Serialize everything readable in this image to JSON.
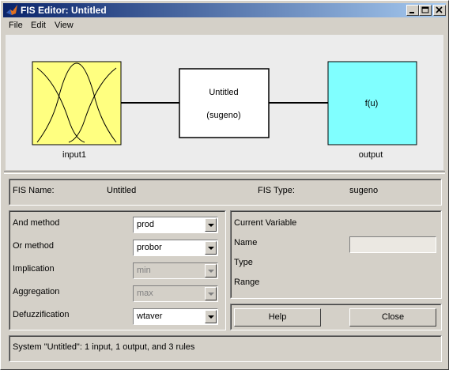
{
  "window": {
    "title": "FIS Editor: Untitled"
  },
  "menu": [
    "File",
    "Edit",
    "View"
  ],
  "diagram": {
    "input_label": "input1",
    "output_label": "output",
    "system_name": "Untitled",
    "system_type": "(sugeno)",
    "output_function": "f(u)",
    "colors": {
      "input_box": "#ffff80",
      "output_box": "#80ffff",
      "system_box": "#ffffff"
    }
  },
  "info": {
    "fis_name_label": "FIS Name:",
    "fis_name_value": "Untitled",
    "fis_type_label": "FIS Type:",
    "fis_type_value": "sugeno"
  },
  "methods": [
    {
      "label": "And method",
      "value": "prod",
      "enabled": true
    },
    {
      "label": "Or method",
      "value": "probor",
      "enabled": true
    },
    {
      "label": "Implication",
      "value": "min",
      "enabled": false
    },
    {
      "label": "Aggregation",
      "value": "max",
      "enabled": false
    },
    {
      "label": "Defuzzification",
      "value": "wtaver",
      "enabled": true
    }
  ],
  "current_variable": {
    "heading": "Current Variable",
    "name_label": "Name",
    "type_label": "Type",
    "range_label": "Range",
    "name_value": ""
  },
  "buttons": {
    "help": "Help",
    "close": "Close"
  },
  "status": "System \"Untitled\": 1 input, 1 output, and 3 rules"
}
